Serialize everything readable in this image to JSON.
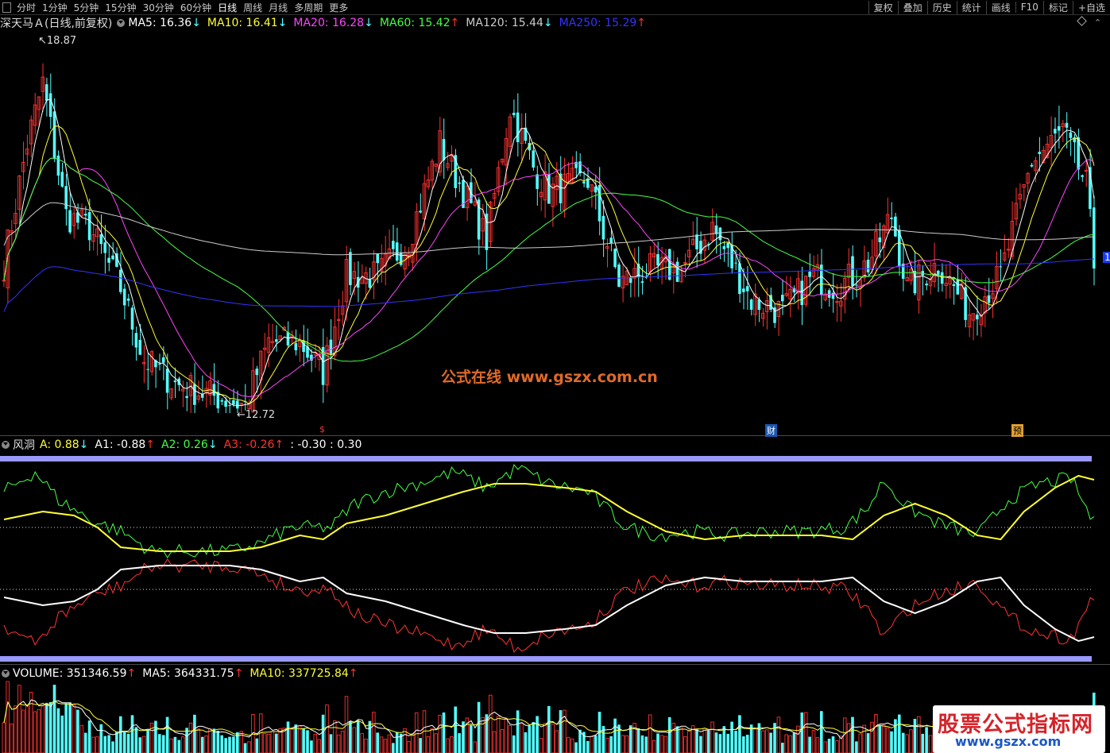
{
  "toolbar": {
    "periods": [
      "分时",
      "1分钟",
      "5分钟",
      "15分钟",
      "30分钟",
      "60分钟",
      "日线",
      "周线",
      "月线",
      "多周期",
      "更多"
    ],
    "active_period": "日线",
    "right_buttons": [
      "复权",
      "叠加",
      "历史",
      "统计",
      "画线",
      "F10",
      "标记",
      "+自选"
    ]
  },
  "main_panel": {
    "title": "深天马Ａ(日线,前复权)",
    "indicators": [
      {
        "label": "MA5: 16.36",
        "arrow": "↓",
        "color": "#ffffff"
      },
      {
        "label": "MA10: 16.41",
        "arrow": "↓",
        "color": "#ffff33"
      },
      {
        "label": "MA20: 16.28",
        "arrow": "↓",
        "color": "#ff44ff"
      },
      {
        "label": "MA60: 15.42",
        "arrow": "↑",
        "color": "#44ff44"
      },
      {
        "label": "MA120: 15.44",
        "arrow": "↓",
        "color": "#cccccc"
      },
      {
        "label": "MA250: 15.29",
        "arrow": "↑",
        "color": "#3333ff"
      }
    ],
    "high_label": "18.87",
    "low_label": "12.72",
    "events": [
      {
        "text": "$",
        "color": "#ff3333"
      },
      {
        "text": "财",
        "color": "#55aaff"
      },
      {
        "text": "预",
        "color": "#ffaa33"
      }
    ],
    "right_price_marker": "1"
  },
  "indicator_panel": {
    "name": "风洞",
    "items": [
      {
        "label": "A: 0.88",
        "arrow": "↓",
        "color": "#ffff33"
      },
      {
        "label": "A1: -0.88",
        "arrow": "↑",
        "color": "#ffffff"
      },
      {
        "label": "A2: 0.26",
        "arrow": "↓",
        "color": "#44ff44"
      },
      {
        "label": "A3: -0.26",
        "arrow": "↑",
        "color": "#ff3333"
      },
      {
        "label": ": -0.30 : 0.30",
        "arrow": "",
        "color": "#ffffff"
      }
    ]
  },
  "volume_panel": {
    "items": [
      {
        "label": "VOLUME: 351346.59",
        "arrow": "↑",
        "color": "#ffffff"
      },
      {
        "label": "MA5: 364331.75",
        "arrow": "↑",
        "color": "#ffffff"
      },
      {
        "label": "MA10: 337725.84",
        "arrow": "↑",
        "color": "#ffff33"
      }
    ]
  },
  "watermark": "公式在线  www.gszx.com.cn",
  "badge": {
    "title": "股票公式指标网",
    "url": "www.gszx.com"
  },
  "colors": {
    "up": "#ff3232",
    "down": "#54ffff",
    "ma5": "#ffffff",
    "ma10": "#ffff33",
    "ma20": "#ff44ff",
    "ma60": "#44ff44",
    "ma120": "#cccccc",
    "ma250": "#3333ff"
  },
  "chart_data": {
    "type": "line",
    "price_range": [
      12.72,
      18.87
    ],
    "close_anchors": [
      [
        0,
        15.2
      ],
      [
        6,
        17.2
      ],
      [
        10,
        18.2
      ],
      [
        16,
        16.0
      ],
      [
        22,
        15.8
      ],
      [
        30,
        14.8
      ],
      [
        36,
        13.6
      ],
      [
        44,
        13.2
      ],
      [
        54,
        13.0
      ],
      [
        62,
        12.85
      ],
      [
        68,
        13.9
      ],
      [
        76,
        13.9
      ],
      [
        82,
        13.4
      ],
      [
        88,
        15.0
      ],
      [
        96,
        15.0
      ],
      [
        104,
        15.6
      ],
      [
        112,
        17.2
      ],
      [
        118,
        16.4
      ],
      [
        124,
        15.6
      ],
      [
        130,
        17.8
      ],
      [
        136,
        16.8
      ],
      [
        140,
        16.4
      ],
      [
        150,
        16.6
      ],
      [
        158,
        14.9
      ],
      [
        166,
        15.1
      ],
      [
        174,
        15.1
      ],
      [
        182,
        15.8
      ],
      [
        192,
        14.6
      ],
      [
        200,
        14.4
      ],
      [
        208,
        15.0
      ],
      [
        214,
        14.8
      ],
      [
        222,
        15.2
      ],
      [
        228,
        16.0
      ],
      [
        232,
        14.8
      ],
      [
        240,
        15.2
      ],
      [
        248,
        14.4
      ],
      [
        256,
        15.0
      ],
      [
        264,
        16.9
      ],
      [
        272,
        17.4
      ],
      [
        278,
        16.5
      ],
      [
        280,
        15.2
      ]
    ],
    "osc_green_anchors": [
      [
        0,
        0.45
      ],
      [
        8,
        0.7
      ],
      [
        14,
        0.35
      ],
      [
        22,
        0.1
      ],
      [
        30,
        -0.05
      ],
      [
        38,
        -0.3
      ],
      [
        48,
        -0.3
      ],
      [
        58,
        -0.3
      ],
      [
        66,
        -0.2
      ],
      [
        74,
        0.0
      ],
      [
        84,
        0.0
      ],
      [
        90,
        0.3
      ],
      [
        98,
        0.45
      ],
      [
        106,
        0.55
      ],
      [
        116,
        0.7
      ],
      [
        124,
        0.5
      ],
      [
        132,
        0.75
      ],
      [
        140,
        0.55
      ],
      [
        150,
        0.45
      ],
      [
        160,
        0.0
      ],
      [
        168,
        -0.1
      ],
      [
        178,
        -0.05
      ],
      [
        186,
        -0.1
      ],
      [
        196,
        -0.05
      ],
      [
        206,
        -0.05
      ],
      [
        216,
        0.0
      ],
      [
        222,
        0.25
      ],
      [
        226,
        0.6
      ],
      [
        232,
        0.25
      ],
      [
        240,
        0.05
      ],
      [
        250,
        -0.1
      ],
      [
        258,
        0.35
      ],
      [
        266,
        0.55
      ],
      [
        274,
        0.62
      ],
      [
        280,
        0.05
      ]
    ],
    "osc_yellow_anchors": [
      [
        0,
        0.1
      ],
      [
        10,
        0.2
      ],
      [
        18,
        0.15
      ],
      [
        24,
        0.0
      ],
      [
        30,
        -0.25
      ],
      [
        40,
        -0.3
      ],
      [
        50,
        -0.3
      ],
      [
        58,
        -0.3
      ],
      [
        66,
        -0.25
      ],
      [
        76,
        -0.1
      ],
      [
        82,
        -0.15
      ],
      [
        88,
        0.05
      ],
      [
        98,
        0.15
      ],
      [
        108,
        0.3
      ],
      [
        118,
        0.45
      ],
      [
        126,
        0.55
      ],
      [
        134,
        0.55
      ],
      [
        144,
        0.5
      ],
      [
        152,
        0.45
      ],
      [
        160,
        0.2
      ],
      [
        170,
        -0.05
      ],
      [
        180,
        -0.15
      ],
      [
        190,
        -0.1
      ],
      [
        200,
        -0.1
      ],
      [
        210,
        -0.1
      ],
      [
        218,
        -0.15
      ],
      [
        226,
        0.15
      ],
      [
        234,
        0.3
      ],
      [
        242,
        0.15
      ],
      [
        250,
        -0.1
      ],
      [
        256,
        -0.15
      ],
      [
        262,
        0.2
      ],
      [
        270,
        0.5
      ],
      [
        276,
        0.65
      ],
      [
        280,
        0.6
      ]
    ]
  }
}
